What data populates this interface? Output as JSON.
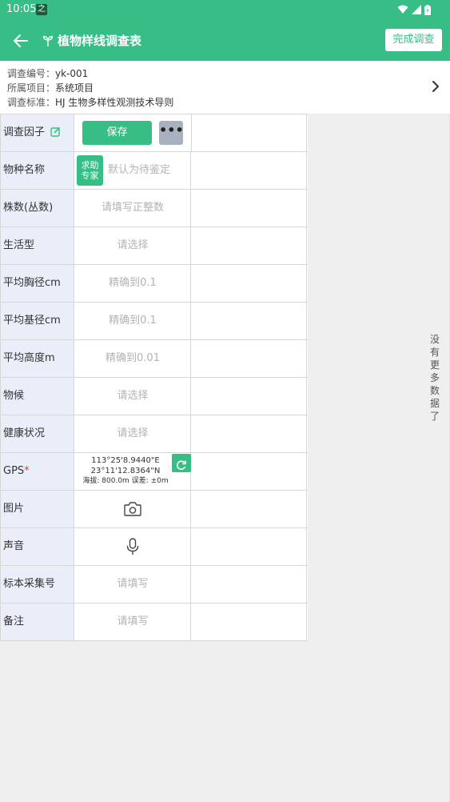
{
  "status": {
    "time": "10:05",
    "badge": "之"
  },
  "header": {
    "title": "植物样线调查表",
    "finish_label": "完成调查"
  },
  "info": {
    "survey_code_label": "调查编号：",
    "survey_code": "yk-001",
    "project_label": "所属项目：",
    "project": "系统项目",
    "standard_label": "调查标准：",
    "standard": "HJ 生物多样性观测技术导则"
  },
  "table": {
    "factor_label": "调查因子",
    "save_label": "保存",
    "more_label": "•••",
    "rows": [
      {
        "label": "物种名称",
        "placeholder": "默认为待鉴定"
      },
      {
        "label": "株数(丛数)",
        "placeholder": "请填写正整数"
      },
      {
        "label": "生活型",
        "placeholder": "请选择"
      },
      {
        "label": "平均胸径cm",
        "placeholder": "精确到0.1"
      },
      {
        "label": "平均基径cm",
        "placeholder": "精确到0.1"
      },
      {
        "label": "平均高度m",
        "placeholder": "精确到0.01"
      },
      {
        "label": "物候",
        "placeholder": "请选择"
      },
      {
        "label": "健康状况",
        "placeholder": "请选择"
      },
      {
        "label": "GPS",
        "placeholder": ""
      },
      {
        "label": "图片",
        "placeholder": ""
      },
      {
        "label": "声音",
        "placeholder": ""
      },
      {
        "label": "标本采集号",
        "placeholder": "请填写"
      },
      {
        "label": "备注",
        "placeholder": "请填写"
      }
    ],
    "help_label_1": "求助",
    "help_label_2": "专家",
    "gps": {
      "lon": "113°25'8.9440\"E",
      "lat": "23°11'12.8364\"N",
      "meta": "海拔: 800.0m  误差: ±0m",
      "required_mark": "*"
    }
  },
  "side_note": [
    "没",
    "有",
    "更",
    "多",
    "数",
    "据",
    "了"
  ],
  "colors": {
    "accent": "#37be86",
    "label_bg": "#e9eef9",
    "placeholder": "#b3b3b3"
  },
  "icons": [
    "back-arrow-icon",
    "plant-icon",
    "chevron-right-icon",
    "edit-icon",
    "camera-icon",
    "microphone-icon",
    "refresh-icon",
    "wifi-icon",
    "signal-icon",
    "battery-icon"
  ]
}
